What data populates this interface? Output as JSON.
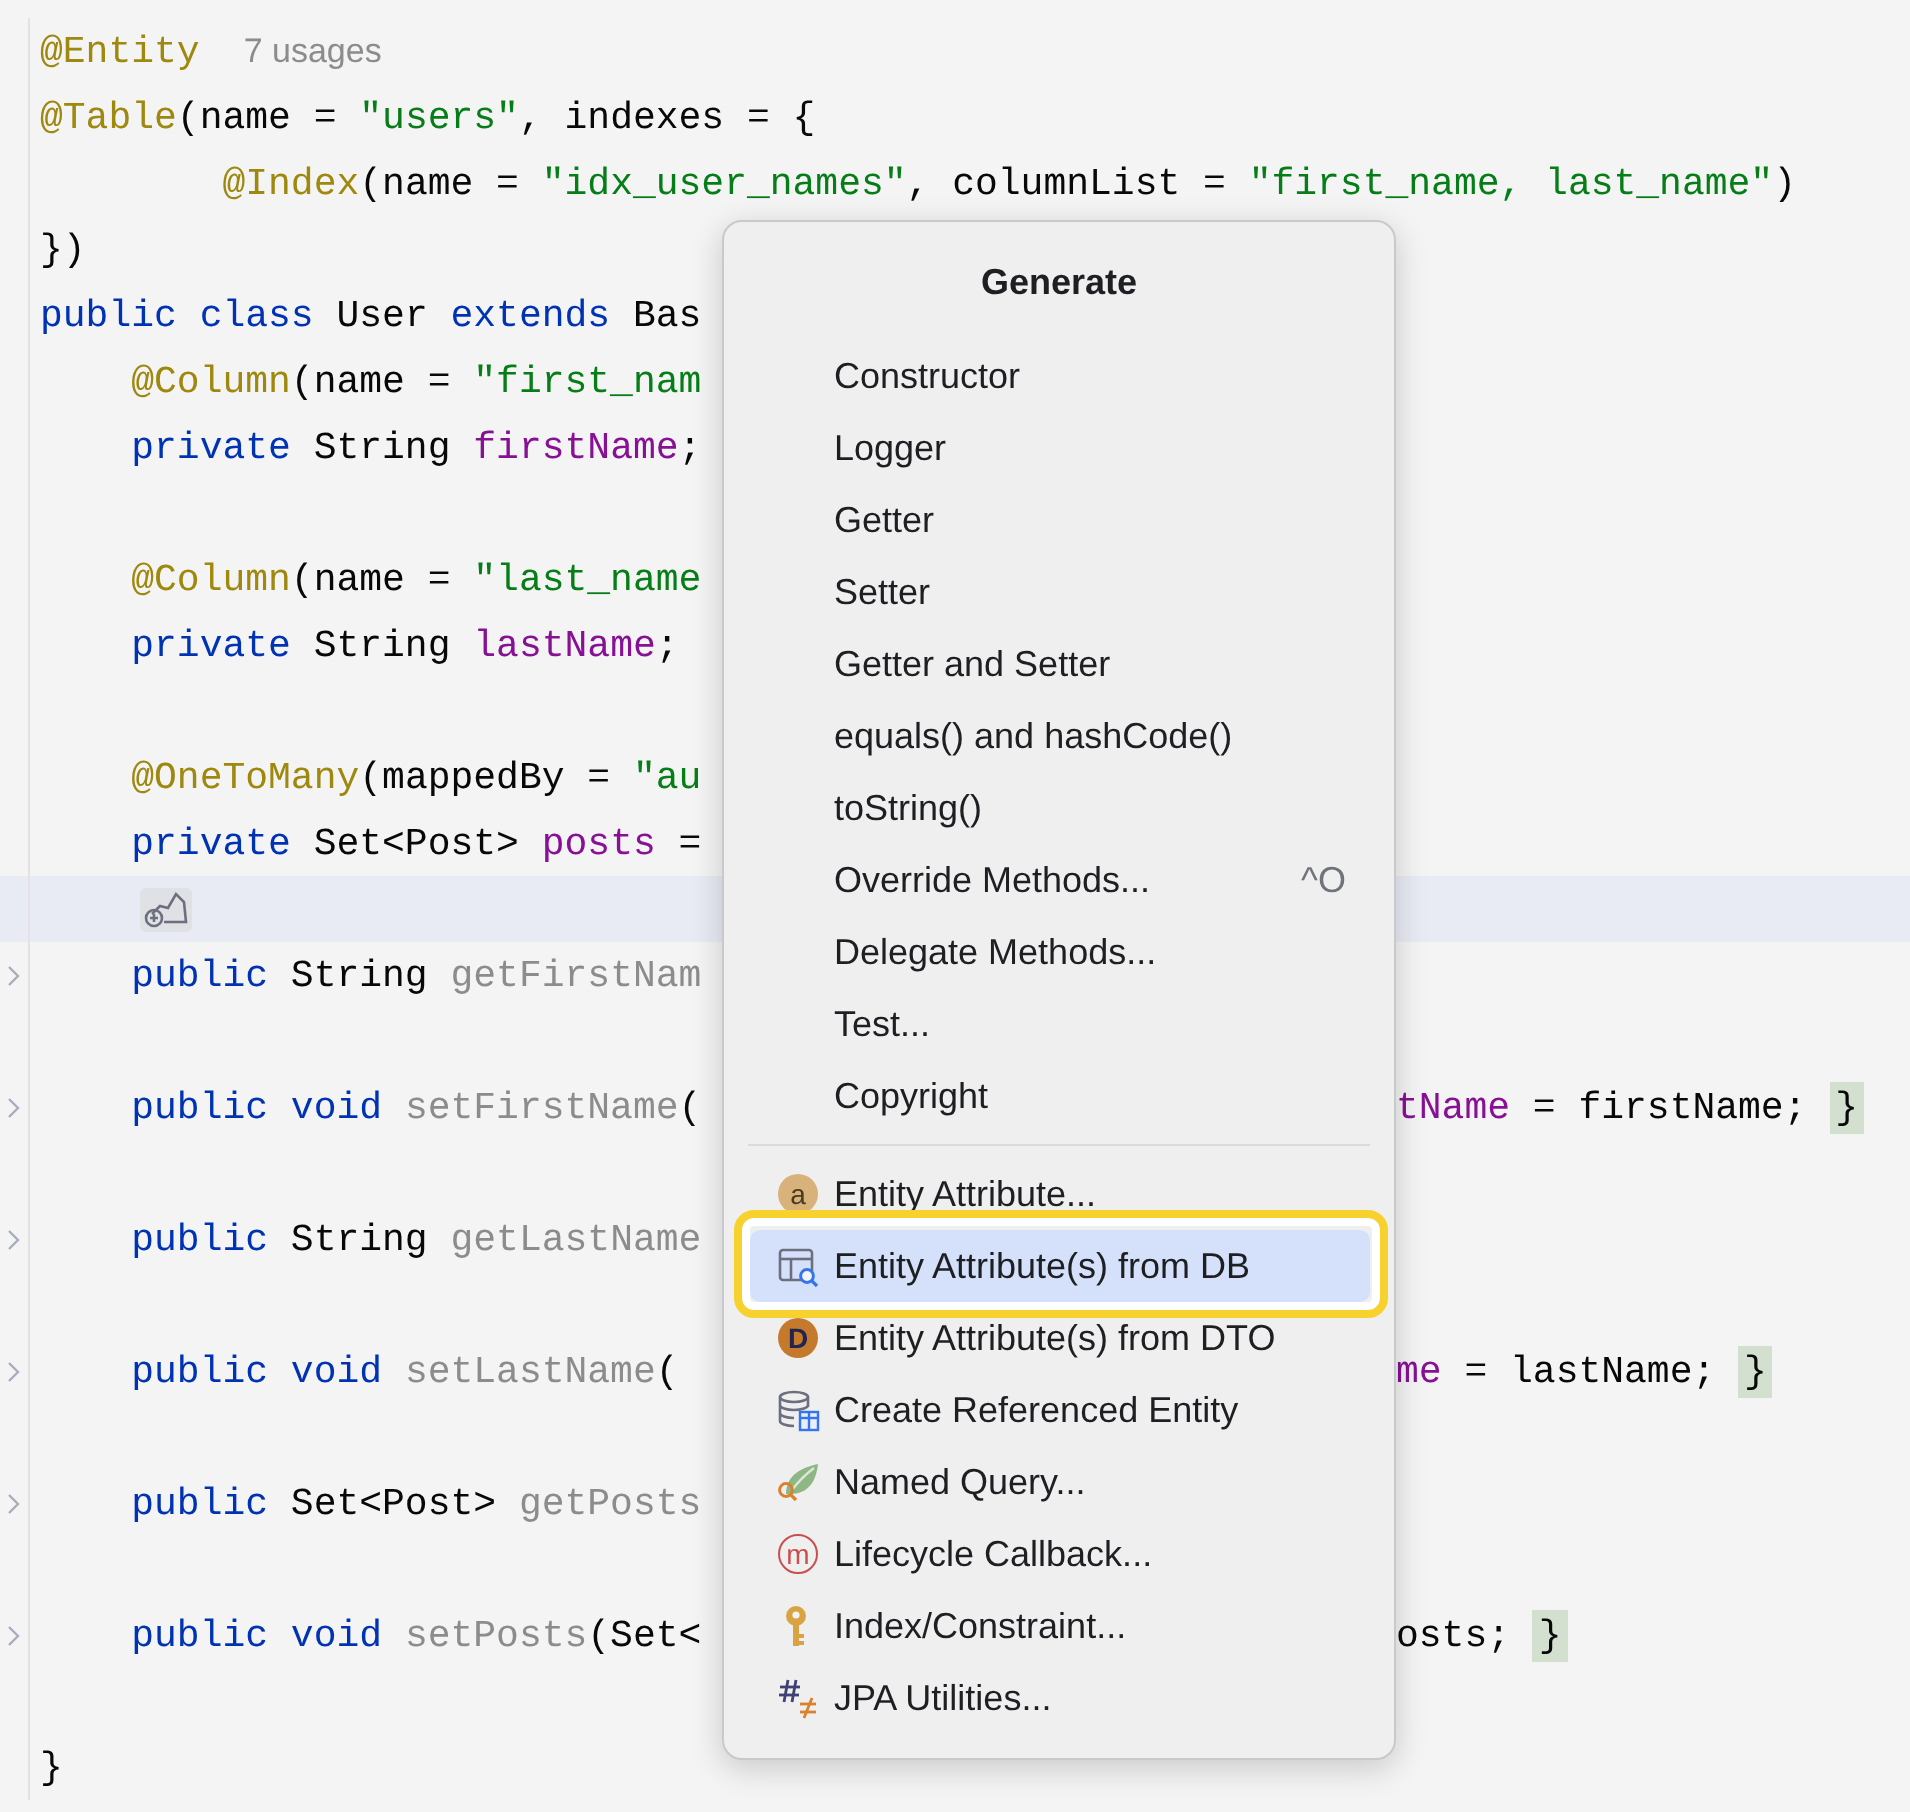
{
  "editor": {
    "lines": [
      {
        "current": false,
        "foldable": false,
        "tokens": [
          {
            "text": "@Entity",
            "kind": "annotation"
          },
          {
            "text": "7 usages",
            "kind": "inlay"
          }
        ]
      },
      {
        "current": false,
        "foldable": false,
        "tokens": [
          {
            "text": "@Table",
            "kind": "annotation"
          },
          {
            "text": "(name = ",
            "kind": "plain"
          },
          {
            "text": "\"users\"",
            "kind": "string"
          },
          {
            "text": ", indexes = {",
            "kind": "plain"
          }
        ]
      },
      {
        "current": false,
        "foldable": false,
        "tokens": [
          {
            "text": "        @Index",
            "kind": "annotation"
          },
          {
            "text": "(name = ",
            "kind": "plain"
          },
          {
            "text": "\"idx_user_names\"",
            "kind": "string"
          },
          {
            "text": ", columnList = ",
            "kind": "plain"
          },
          {
            "text": "\"first_name, last_name\"",
            "kind": "string"
          },
          {
            "text": ")",
            "kind": "plain"
          }
        ]
      },
      {
        "current": false,
        "foldable": false,
        "tokens": [
          {
            "text": "})",
            "kind": "plain"
          }
        ]
      },
      {
        "current": false,
        "foldable": false,
        "tokens": [
          {
            "text": "public class ",
            "kind": "keyword"
          },
          {
            "text": "User ",
            "kind": "plain"
          },
          {
            "text": "extends ",
            "kind": "keyword"
          },
          {
            "text": "Bas",
            "kind": "plain"
          }
        ]
      },
      {
        "current": false,
        "foldable": false,
        "tokens": [
          {
            "text": "    @Column",
            "kind": "annotation"
          },
          {
            "text": "(name = ",
            "kind": "plain"
          },
          {
            "text": "\"first_nam",
            "kind": "string"
          }
        ]
      },
      {
        "current": false,
        "foldable": false,
        "tokens": [
          {
            "text": "    private ",
            "kind": "keyword"
          },
          {
            "text": "String ",
            "kind": "plain"
          },
          {
            "text": "firstName",
            "kind": "field"
          },
          {
            "text": ";",
            "kind": "plain"
          }
        ]
      },
      {
        "current": false,
        "foldable": false
      },
      {
        "current": false,
        "foldable": false,
        "tokens": [
          {
            "text": "    @Column",
            "kind": "annotation"
          },
          {
            "text": "(name = ",
            "kind": "plain"
          },
          {
            "text": "\"last_name",
            "kind": "string"
          }
        ]
      },
      {
        "current": false,
        "foldable": false,
        "tokens": [
          {
            "text": "    private ",
            "kind": "keyword"
          },
          {
            "text": "String ",
            "kind": "plain"
          },
          {
            "text": "lastName",
            "kind": "field"
          },
          {
            "text": ";",
            "kind": "plain"
          }
        ]
      },
      {
        "current": false,
        "foldable": false
      },
      {
        "current": false,
        "foldable": false,
        "tokens": [
          {
            "text": "    @OneToMany",
            "kind": "annotation"
          },
          {
            "text": "(mappedBy = ",
            "kind": "plain"
          },
          {
            "text": "\"au",
            "kind": "string"
          }
        ]
      },
      {
        "current": false,
        "foldable": false,
        "tokens": [
          {
            "text": "    private ",
            "kind": "keyword"
          },
          {
            "text": "Set<Post> ",
            "kind": "plain"
          },
          {
            "text": "posts",
            "kind": "field"
          },
          {
            "text": " =",
            "kind": "plain"
          }
        ]
      },
      {
        "current": true,
        "foldable": false,
        "kind": "intention"
      },
      {
        "current": false,
        "foldable": true,
        "tokens": [
          {
            "text": "    public ",
            "kind": "keyword"
          },
          {
            "text": "String ",
            "kind": "plain"
          },
          {
            "text": "getFirstNam",
            "kind": "method"
          }
        ]
      },
      {
        "current": false,
        "foldable": false
      },
      {
        "current": false,
        "foldable": true,
        "tokens": [
          {
            "text": "    public void ",
            "kind": "keyword"
          },
          {
            "text": "setFirstName",
            "kind": "method"
          },
          {
            "text": "(",
            "kind": "plain"
          }
        ],
        "right_tokens": [
          {
            "text": "tName",
            "kind": "field"
          },
          {
            "text": " = firstName; ",
            "kind": "plain"
          },
          {
            "text": "}",
            "kind": "brace"
          }
        ]
      },
      {
        "current": false,
        "foldable": false
      },
      {
        "current": false,
        "foldable": true,
        "tokens": [
          {
            "text": "    public ",
            "kind": "keyword"
          },
          {
            "text": "String ",
            "kind": "plain"
          },
          {
            "text": "getLastName",
            "kind": "method"
          }
        ]
      },
      {
        "current": false,
        "foldable": false
      },
      {
        "current": false,
        "foldable": true,
        "tokens": [
          {
            "text": "    public void ",
            "kind": "keyword"
          },
          {
            "text": "setLastName",
            "kind": "method"
          },
          {
            "text": "(",
            "kind": "plain"
          }
        ],
        "right_tokens": [
          {
            "text": "me",
            "kind": "field"
          },
          {
            "text": " = lastName; ",
            "kind": "plain"
          },
          {
            "text": "}",
            "kind": "brace"
          }
        ]
      },
      {
        "current": false,
        "foldable": false
      },
      {
        "current": false,
        "foldable": true,
        "tokens": [
          {
            "text": "    public ",
            "kind": "keyword"
          },
          {
            "text": "Set<Post> ",
            "kind": "plain"
          },
          {
            "text": "getPosts",
            "kind": "method"
          }
        ]
      },
      {
        "current": false,
        "foldable": false
      },
      {
        "current": false,
        "foldable": true,
        "tokens": [
          {
            "text": "    public void ",
            "kind": "keyword"
          },
          {
            "text": "setPosts",
            "kind": "method"
          },
          {
            "text": "(Set<",
            "kind": "plain"
          }
        ],
        "right_tokens": [
          {
            "text": "osts; ",
            "kind": "plain"
          },
          {
            "text": "}",
            "kind": "brace"
          }
        ]
      },
      {
        "current": false,
        "foldable": false
      },
      {
        "current": false,
        "foldable": false,
        "tokens": [
          {
            "text": "}",
            "kind": "plain"
          }
        ]
      }
    ]
  },
  "popup": {
    "title": "Generate",
    "groups": [
      {
        "kind": "plain",
        "items": [
          {
            "label": "Constructor",
            "selected": false,
            "outlined": false
          },
          {
            "label": "Logger",
            "selected": false,
            "outlined": false
          },
          {
            "label": "Getter",
            "selected": false,
            "outlined": false
          },
          {
            "label": "Setter",
            "selected": false,
            "outlined": false
          },
          {
            "label": "Getter and Setter",
            "selected": false,
            "outlined": false
          },
          {
            "label": "equals() and hashCode()",
            "selected": false,
            "outlined": false
          },
          {
            "label": "toString()",
            "selected": false,
            "outlined": false
          },
          {
            "label": "Override Methods...",
            "shortcut": "^O",
            "selected": false,
            "outlined": false
          },
          {
            "label": "Delegate Methods...",
            "selected": false,
            "outlined": false
          },
          {
            "label": "Test...",
            "selected": false,
            "outlined": false
          },
          {
            "label": "Copyright",
            "selected": false,
            "outlined": false
          }
        ]
      },
      {
        "kind": "icons",
        "items": [
          {
            "label": "Entity Attribute...",
            "icon_letter": "a",
            "selected": false,
            "outlined": false
          },
          {
            "label": "Entity Attribute(s) from DB",
            "selected": true,
            "outlined": true
          },
          {
            "label": "Entity Attribute(s) from DTO",
            "icon_letter": "D",
            "selected": false,
            "outlined": false
          },
          {
            "label": "Create Referenced Entity",
            "selected": false,
            "outlined": false
          },
          {
            "label": "Named Query...",
            "selected": false,
            "outlined": false
          },
          {
            "label": "Lifecycle Callback...",
            "icon_letter": "m",
            "selected": false,
            "outlined": false
          },
          {
            "label": "Index/Constraint...",
            "selected": false,
            "outlined": false
          },
          {
            "label": "JPA Utilities...",
            "selected": false,
            "outlined": false
          }
        ]
      }
    ]
  }
}
